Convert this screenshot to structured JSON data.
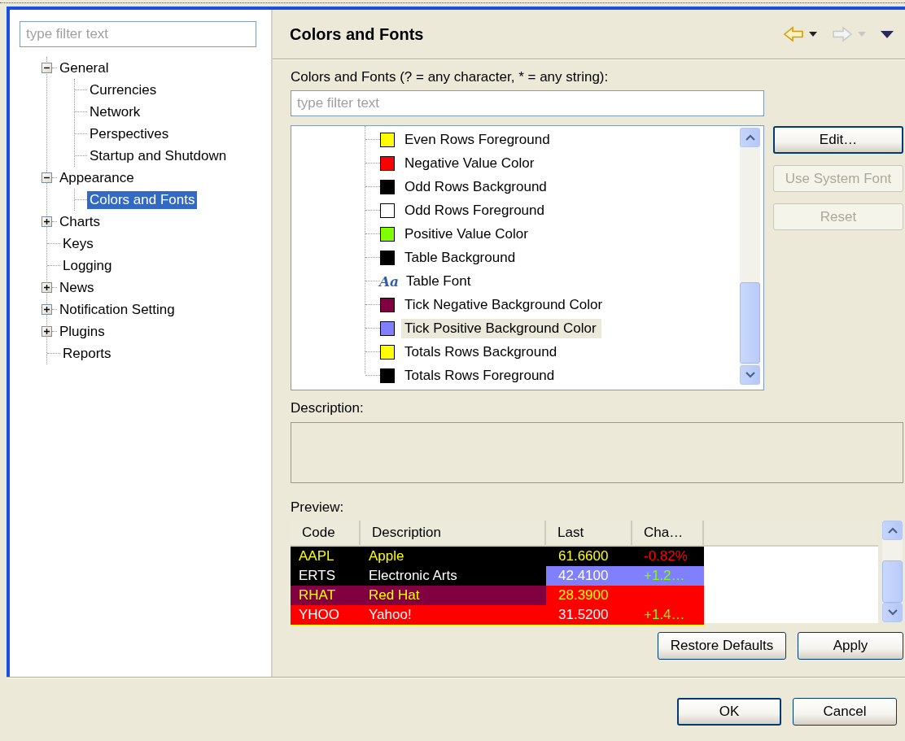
{
  "filter": {
    "placeholder": "type filter text"
  },
  "tree": [
    {
      "label": "General",
      "kind": "folder",
      "expanded": true,
      "selected": false,
      "children": [
        {
          "label": "Currencies",
          "selected": false
        },
        {
          "label": "Network",
          "selected": false
        },
        {
          "label": "Perspectives",
          "selected": false
        },
        {
          "label": "Startup and Shutdown",
          "selected": false
        }
      ]
    },
    {
      "label": "Appearance",
      "kind": "folder",
      "expanded": true,
      "selected": false,
      "children": [
        {
          "label": "Colors and Fonts",
          "selected": true
        }
      ]
    },
    {
      "label": "Charts",
      "kind": "folder",
      "expanded": false,
      "selected": false
    },
    {
      "label": "Keys",
      "kind": "leaf",
      "selected": false
    },
    {
      "label": "Logging",
      "kind": "leaf",
      "selected": false
    },
    {
      "label": "News",
      "kind": "folder",
      "expanded": false,
      "selected": false
    },
    {
      "label": "Notification Setting",
      "kind": "folder",
      "expanded": false,
      "selected": false
    },
    {
      "label": "Plugins",
      "kind": "folder",
      "expanded": false,
      "selected": false
    },
    {
      "label": "Reports",
      "kind": "leaf",
      "selected": false
    }
  ],
  "page": {
    "title": "Colors and Fonts",
    "nav": [
      {
        "kind": "back",
        "disabled": false
      },
      {
        "kind": "forward",
        "disabled": true
      }
    ],
    "filter_label": "Colors and Fonts (? = any character, * = any string):",
    "filter": {
      "placeholder": "type filter text"
    },
    "items": [
      {
        "label": "Even Rows Foreground",
        "kind": "color",
        "color": "#ffff00",
        "selected": false
      },
      {
        "label": "Negative Value Color",
        "kind": "color",
        "color": "#ff0000",
        "selected": false
      },
      {
        "label": "Odd Rows Background",
        "kind": "color",
        "color": "#000000",
        "selected": false
      },
      {
        "label": "Odd Rows Foreground",
        "kind": "color",
        "color": "#ffffff",
        "selected": false
      },
      {
        "label": "Positive Value Color",
        "kind": "color",
        "color": "#80ff00",
        "selected": false
      },
      {
        "label": "Table Background",
        "kind": "color",
        "color": "#000000",
        "selected": false
      },
      {
        "label": "Table Font",
        "kind": "font",
        "glyph": "Aa",
        "selected": false
      },
      {
        "label": "Tick Negative Background Color",
        "kind": "color",
        "color": "#800040",
        "selected": false
      },
      {
        "label": "Tick Positive Background Color",
        "kind": "color",
        "color": "#8080ff",
        "selected": true
      },
      {
        "label": "Totals Rows Background",
        "kind": "color",
        "color": "#ffff00",
        "selected": false
      },
      {
        "label": "Totals Rows Foreground",
        "kind": "color",
        "color": "#000000",
        "selected": false
      }
    ],
    "buttons": [
      {
        "label": "Edit…",
        "disabled": false
      },
      {
        "label": "Use System Font",
        "disabled": true
      },
      {
        "label": "Reset",
        "disabled": true
      }
    ],
    "description_label": "Description:",
    "preview_label": "Preview:",
    "preview": {
      "columns": [
        "Code",
        "Description",
        "Last",
        "Cha…"
      ],
      "rows": [
        {
          "cells": [
            {
              "label": {
                "text": "AAPL",
                "color": "#ffff00"
              },
              "fill": {
                "color": "#000000"
              }
            },
            {
              "label": {
                "text": "Apple",
                "color": "#ffff00"
              },
              "fill": {
                "color": "#000000"
              }
            },
            {
              "label": {
                "text": "61.6600",
                "color": "#ffff00"
              },
              "fill": {
                "color": "#000000"
              }
            },
            {
              "label": {
                "text": "-0.82%",
                "color": "#ff0000"
              },
              "fill": {
                "color": "#000000"
              }
            }
          ]
        },
        {
          "cells": [
            {
              "label": {
                "text": "ERTS",
                "color": "#ffffff"
              },
              "fill": {
                "color": "#000000"
              }
            },
            {
              "label": {
                "text": "Electronic Arts",
                "color": "#ffffff"
              },
              "fill": {
                "color": "#000000"
              }
            },
            {
              "label": {
                "text": "42.4100",
                "color": "#ffffff"
              },
              "fill": {
                "color": "#8080ff"
              }
            },
            {
              "label": {
                "text": "+1.2…",
                "color": "#80ff00"
              },
              "fill": {
                "color": "#8080ff"
              }
            }
          ]
        },
        {
          "cells": [
            {
              "label": {
                "text": "RHAT",
                "color": "#ffff00"
              },
              "fill": {
                "color": "#800040"
              }
            },
            {
              "label": {
                "text": "Red Hat",
                "color": "#ffff00"
              },
              "fill": {
                "color": "#800040"
              }
            },
            {
              "label": {
                "text": "28.3900",
                "color": "#ffff00"
              },
              "fill": {
                "color": "#ff0000"
              }
            },
            {
              "fill": {
                "color": "#ff0000"
              }
            }
          ]
        },
        {
          "cells": [
            {
              "label": {
                "text": "YHOO",
                "color": "#ffffff"
              },
              "fill": {
                "color": "#ff0000"
              }
            },
            {
              "label": {
                "text": "Yahoo!",
                "color": "#ffffff"
              },
              "fill": {
                "color": "#ff0000"
              }
            },
            {
              "label": {
                "text": "31.5200",
                "color": "#ffffff"
              },
              "fill": {
                "color": "#ff0000"
              }
            },
            {
              "label": {
                "text": "+1.4…",
                "color": "#80ff00"
              },
              "fill": {
                "color": "#ff0000"
              }
            }
          ]
        }
      ]
    },
    "page_buttons": [
      "Restore Defaults",
      "Apply"
    ]
  },
  "dialog_buttons": [
    "OK",
    "Cancel"
  ]
}
